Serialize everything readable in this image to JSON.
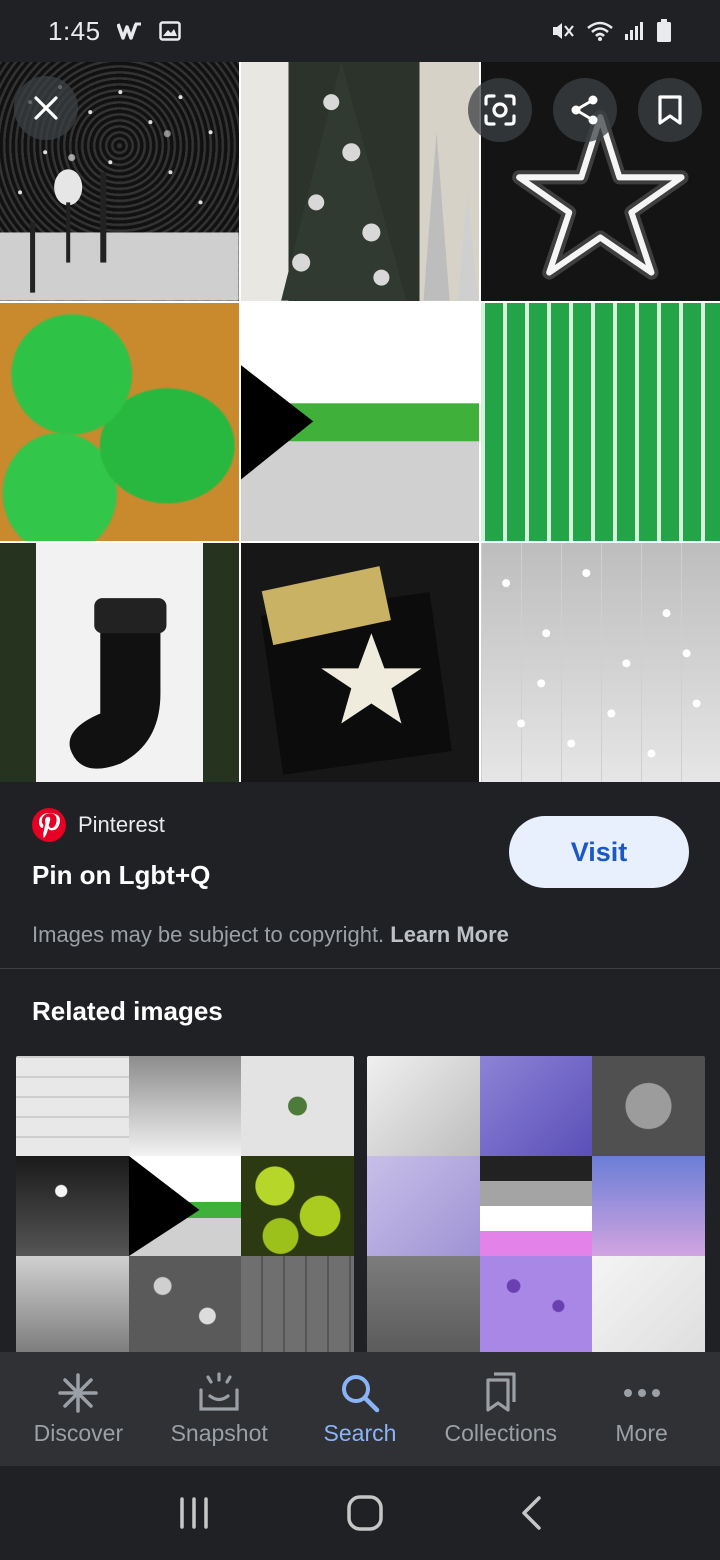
{
  "status_bar": {
    "time": "1:45"
  },
  "source": {
    "name": "Pinterest",
    "title": "Pin on Lgbt+Q",
    "visit_label": "Visit"
  },
  "copyright": {
    "text": "Images may be subject to copyright.",
    "link": "Learn More"
  },
  "related": {
    "title": "Related images"
  },
  "nav": {
    "items": [
      {
        "label": "Discover",
        "icon": "asterisk-icon"
      },
      {
        "label": "Snapshot",
        "icon": "snapshot-icon"
      },
      {
        "label": "Search",
        "icon": "search-icon"
      },
      {
        "label": "Collections",
        "icon": "collections-icon"
      },
      {
        "label": "More",
        "icon": "more-dots-icon"
      }
    ],
    "active": "Search"
  },
  "colors": {
    "background": "#202124",
    "accent": "#8ab4f8",
    "visit_bg": "#e8f0fe",
    "visit_text": "#1a58c5",
    "pinterest_red": "#e60023",
    "flag_green": "#3fb13b"
  }
}
